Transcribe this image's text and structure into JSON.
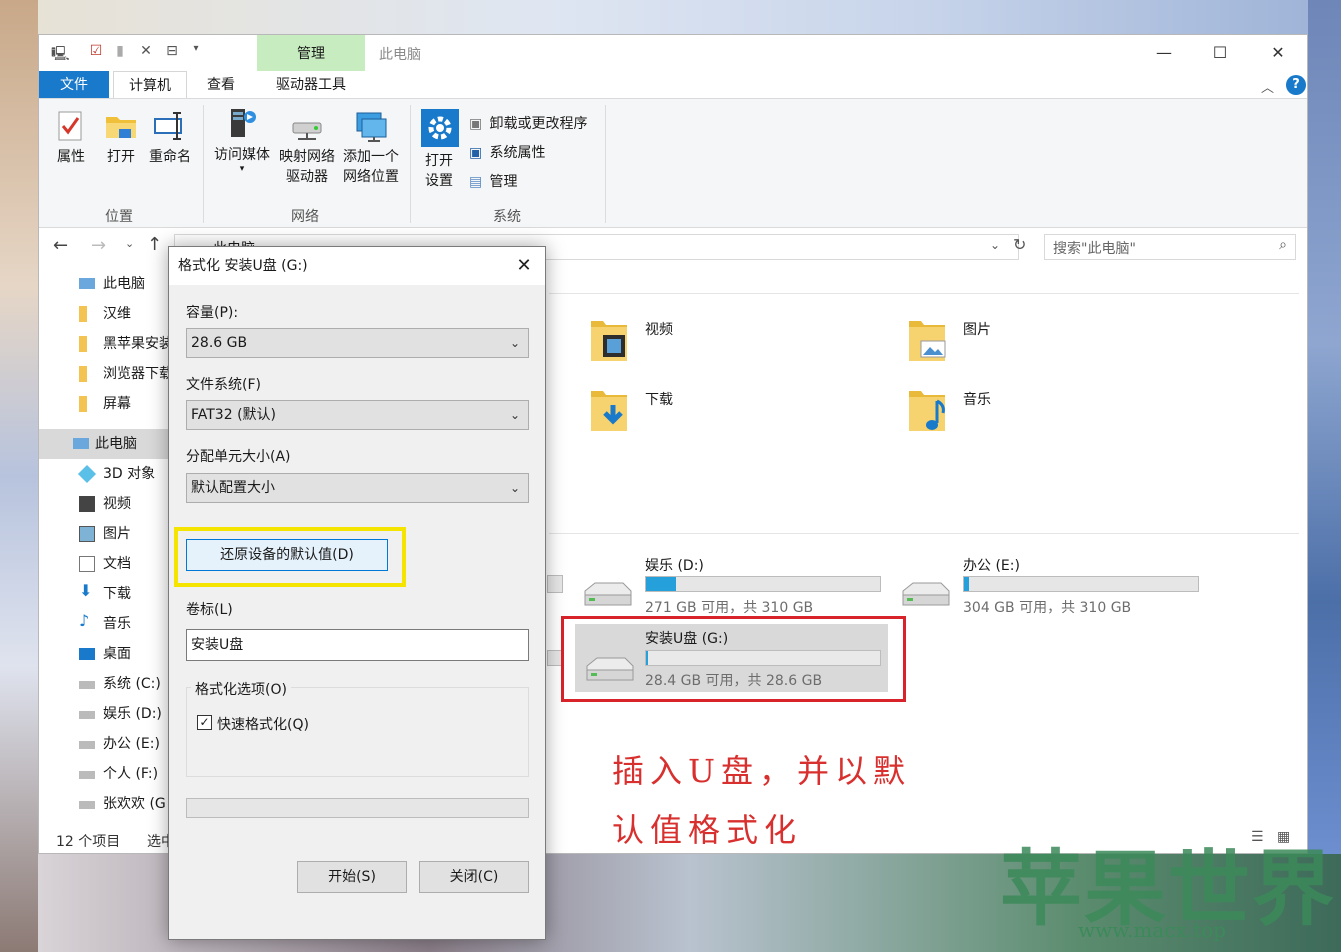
{
  "window": {
    "title": "此电脑",
    "context_tab": "管理",
    "controls": {
      "minimize": "—",
      "maximize": "☐",
      "close": "✕"
    }
  },
  "ribbon": {
    "tabs": [
      "文件",
      "计算机",
      "查看",
      "驱动器工具"
    ],
    "groups": {
      "location": {
        "label": "位置",
        "buttons": [
          "属性",
          "打开",
          "重命名"
        ]
      },
      "network": {
        "label": "网络",
        "buttons": [
          "访问媒体",
          "映射网络\n驱动器",
          "添加一个\n网络位置"
        ]
      },
      "system": {
        "label": "系统",
        "open_settings": "打开\n设置",
        "items": [
          "卸载或更改程序",
          "系统属性",
          "管理"
        ]
      }
    }
  },
  "nav": {
    "address_text": "此电脑",
    "search_placeholder": "搜索\"此电脑\"",
    "tree": [
      "此电脑",
      "汉维",
      "黑苹果安装",
      "浏览器下载",
      "屏幕",
      "此电脑",
      "3D 对象",
      "视频",
      "图片",
      "文档",
      "下载",
      "音乐",
      "桌面",
      "系统 (C:)",
      "娱乐 (D:)",
      "办公 (E:)",
      "个人 (F:)",
      "张欢欢 (G"
    ]
  },
  "folders": [
    {
      "name": "视频",
      "icon": "video-folder-icon"
    },
    {
      "name": "图片",
      "icon": "picture-folder-icon"
    },
    {
      "name": "下载",
      "icon": "download-folder-icon"
    },
    {
      "name": "音乐",
      "icon": "music-folder-icon"
    }
  ],
  "drives": [
    {
      "name": "娱乐 (D:)",
      "free": "271 GB 可用，共 310 GB",
      "used_fraction": 0.13
    },
    {
      "name": "办公 (E:)",
      "free": "304 GB 可用，共 310 GB",
      "used_fraction": 0.02
    },
    {
      "name": "安装U盘 (G:)",
      "free": "28.4 GB 可用，共 28.6 GB",
      "used_fraction": 0.01
    }
  ],
  "status": {
    "count": "12 个项目",
    "selected": "选中"
  },
  "dialog": {
    "title": "格式化 安装U盘 (G:)",
    "capacity_label": "容量(P):",
    "capacity_value": "28.6 GB",
    "fs_label": "文件系统(F)",
    "fs_value": "FAT32 (默认)",
    "alloc_label": "分配单元大小(A)",
    "alloc_value": "默认配置大小",
    "restore_button": "还原设备的默认值(D)",
    "volume_label": "卷标(L)",
    "volume_value": "安装U盘",
    "options_label": "格式化选项(O)",
    "quick_format": "快速格式化(Q)",
    "start_button": "开始(S)",
    "close_button": "关闭(C)"
  },
  "annotation": {
    "line1": "插入U盘，并以默",
    "line2": "认值格式化"
  },
  "watermark": {
    "text": "苹果世界",
    "url": "www.macx.top"
  },
  "colors": {
    "accent": "#1979ca",
    "context_tab": "#c6ecbf",
    "highlight_yellow": "#f5e400",
    "highlight_red": "#d8232a",
    "bar": "#26a0da"
  }
}
